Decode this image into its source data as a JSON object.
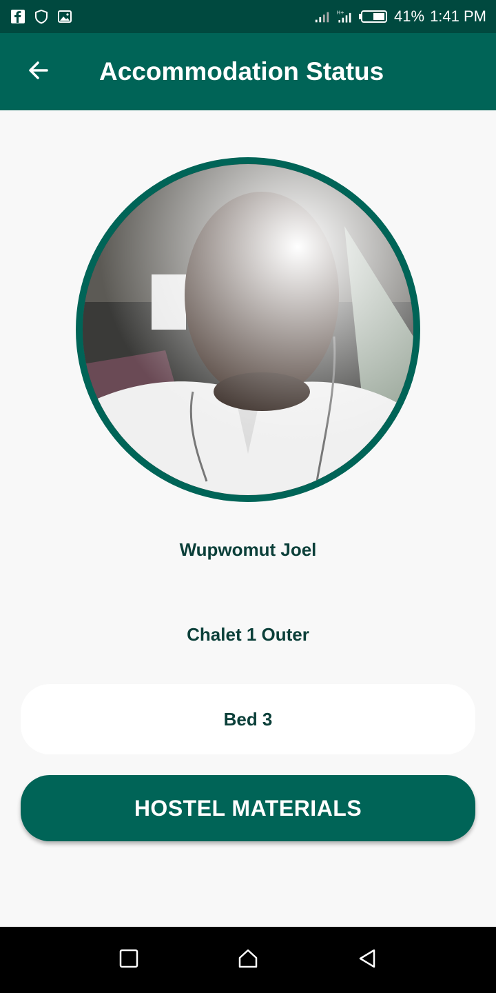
{
  "status_bar": {
    "battery": "41%",
    "time": "1:41 PM",
    "left_icons": [
      "facebook-icon",
      "shield-icon",
      "image-icon"
    ],
    "right_icons": [
      "signal-icon",
      "signal-ht-icon",
      "battery-icon"
    ]
  },
  "app_bar": {
    "title": "Accommodation Status",
    "back_icon": "arrow-left-icon"
  },
  "profile": {
    "name": "Wupwomut Joel",
    "chalet": "Chalet 1 Outer",
    "bed": "Bed 3"
  },
  "actions": {
    "hostel_materials": "HOSTEL MATERIALS"
  },
  "nav": {
    "icons": [
      "recents-icon",
      "home-icon",
      "back-triangle-icon"
    ]
  },
  "colors": {
    "status_bar": "#00493f",
    "primary": "#006457",
    "text_dark": "#0b3f39",
    "background": "#f8f8f8"
  }
}
